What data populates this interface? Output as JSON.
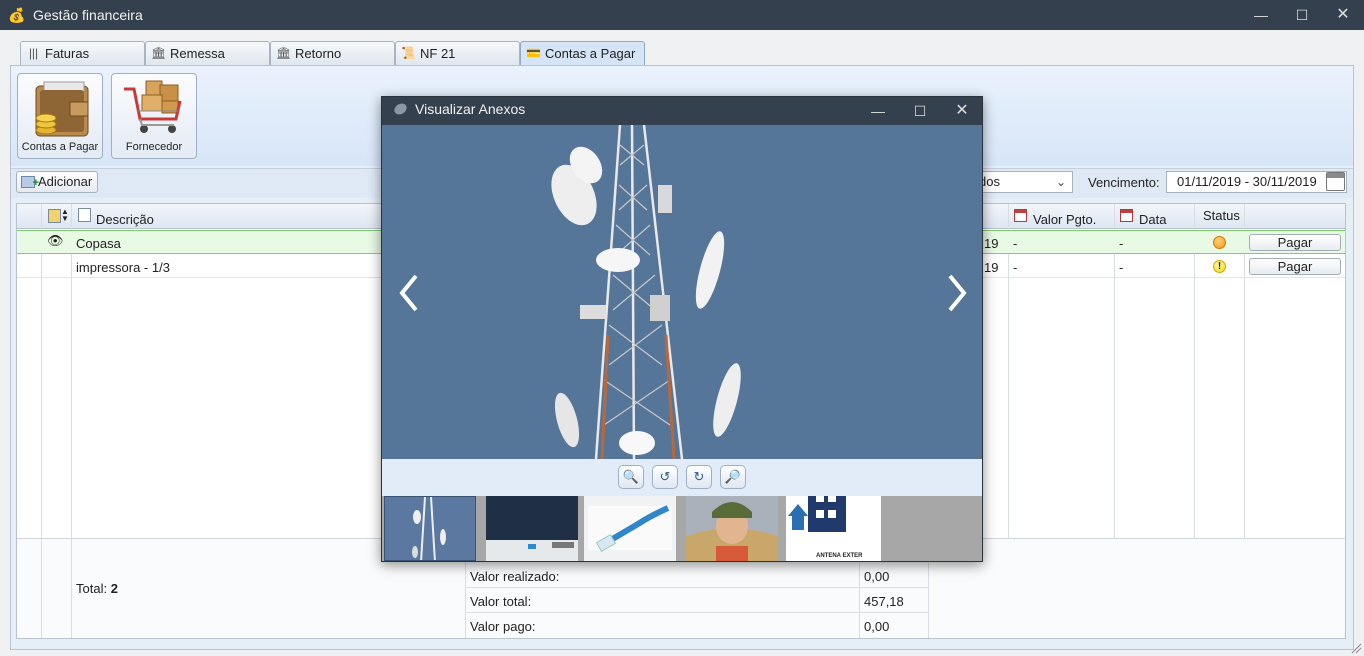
{
  "window": {
    "title": "Gestão financeira",
    "app_icon": "money-bag-icon",
    "minimize": "—",
    "maximize": "☐",
    "close": "✕"
  },
  "tabs": [
    {
      "label": "Faturas",
      "icon": "barcode-icon"
    },
    {
      "label": "Remessa",
      "icon": "bank-icon"
    },
    {
      "label": "Retorno",
      "icon": "bank-icon"
    },
    {
      "label": "NF 21",
      "icon": "certificate-icon"
    },
    {
      "label": "Contas a Pagar",
      "icon": "bill-icon",
      "active": true
    }
  ],
  "ribbon": {
    "contas_label": "Contas a Pagar",
    "fornecedor_label": "Fornecedor"
  },
  "toolbar": {
    "add_label": "Adicionar",
    "filter_value": "dos",
    "venc_label": "Vencimento:",
    "venc_range": "01/11/2019 - 30/11/2019"
  },
  "table": {
    "headers": {
      "descricao": "Descrição",
      "valor_pgto": "Valor Pgto.",
      "data": "Data",
      "status": "Status"
    },
    "rows": [
      {
        "descricao": "Copasa",
        "venc_partial": "19",
        "valor_pgto": "-",
        "data": "-",
        "status": "orange",
        "action": "Pagar"
      },
      {
        "descricao": "impressora - 1/3",
        "venc_partial": "19",
        "valor_pgto": "-",
        "data": "-",
        "status": "warning",
        "action": "Pagar"
      }
    ],
    "footer": {
      "total_label": "Total:",
      "total_value": "2",
      "realizado_label": "Valor realizado:",
      "realizado_value": "0,00",
      "total_valor_label": "Valor total:",
      "total_valor_value": "457,18",
      "pago_label": "Valor pago:",
      "pago_value": "0,00"
    }
  },
  "dialog": {
    "title": "Visualizar Anexos",
    "minimize": "—",
    "maximize": "☐",
    "close": "✕",
    "thumbnails": [
      "antenna-tower",
      "dark-screenshot",
      "network-cable",
      "portrait",
      "antenna-diagram"
    ],
    "thumb_caption": "ANTENA EXTER"
  },
  "colors": {
    "titlebar": "#34404d",
    "sky": "#557599",
    "row_selected": "#e8f9e4"
  }
}
